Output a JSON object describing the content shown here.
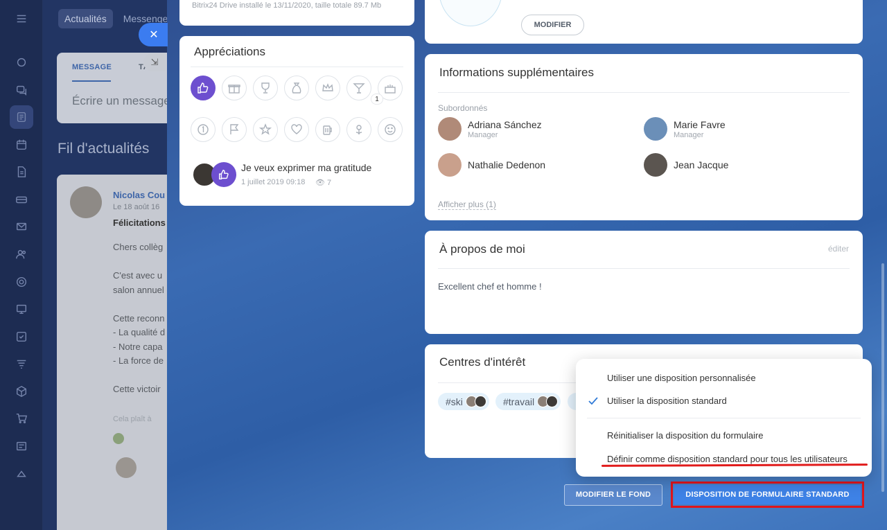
{
  "background": {
    "tabs": [
      "Actualités",
      "Messenger"
    ],
    "post": {
      "tab_message": "MESSAGE",
      "tab_task": "TÂ",
      "placeholder": "Écrire un message"
    },
    "feed_title": "Fil d'actualités",
    "entry": {
      "author": "Nicolas Cou",
      "date": "Le 18 août 16",
      "heading": "Félicitations",
      "lines": [
        "Chers collèg",
        "C'est avec u",
        "salon annuel",
        "Cette reconn",
        "- La qualité d",
        "- Notre capa",
        "- La force de",
        "Cette victoir"
      ],
      "likes_label": "Cela plaît à"
    }
  },
  "drive_note": "Bitrix24 Drive installé le 13/11/2020, taille totale 89.7 Mb",
  "avatar_card": {
    "modify_label": "MODIFIER"
  },
  "appreciations": {
    "title": "Appréciations",
    "badge_count": "1",
    "badges_row1": [
      "thumbs-up-icon",
      "gift-icon",
      "trophy-icon",
      "money-bag-icon",
      "crown-icon",
      "cocktail-icon",
      "cake-icon"
    ],
    "badges_row2": [
      "one-icon",
      "flag-icon",
      "star-icon",
      "heart-icon",
      "beer-icon",
      "flower-icon",
      "smile-icon"
    ],
    "gratitude_title": "Je veux exprimer ma gratitude",
    "gratitude_date": "1 juillet 2019 09:18",
    "gratitude_views": "7"
  },
  "info": {
    "title": "Informations supplémentaires",
    "subordinates_label": "Subordonnés",
    "people": [
      {
        "name": "Adriana Sánchez",
        "role": "Manager",
        "color": "#b08a78"
      },
      {
        "name": "Marie Favre",
        "role": "Manager",
        "color": "#6b8fb8"
      },
      {
        "name": "Nathalie Dedenon",
        "role": "",
        "color": "#c9a08c"
      },
      {
        "name": "Jean Jacque",
        "role": "",
        "color": "#5b5550"
      }
    ],
    "more_link": "Afficher plus (1)"
  },
  "about": {
    "title": "À propos de moi",
    "edit": "éditer",
    "text": "Excellent chef et homme !"
  },
  "interests": {
    "title": "Centres d'intérêt",
    "tags": [
      "#ski",
      "#travail"
    ]
  },
  "menu": {
    "items": [
      "Utiliser une disposition personnalisée",
      "Utiliser la disposition standard",
      "Réinitialiser la disposition du formulaire",
      "Définir comme disposition standard pour tous les utilisateurs"
    ],
    "checked_index": 1
  },
  "buttons": {
    "background": "MODIFIER LE FOND",
    "standard": "DISPOSITION DE FORMULAIRE STANDARD"
  },
  "colors": {
    "accent": "#3e82e6",
    "highlight": "#e1141b",
    "badge_active": "#6d4fcf",
    "check": "#2f7ad7"
  }
}
